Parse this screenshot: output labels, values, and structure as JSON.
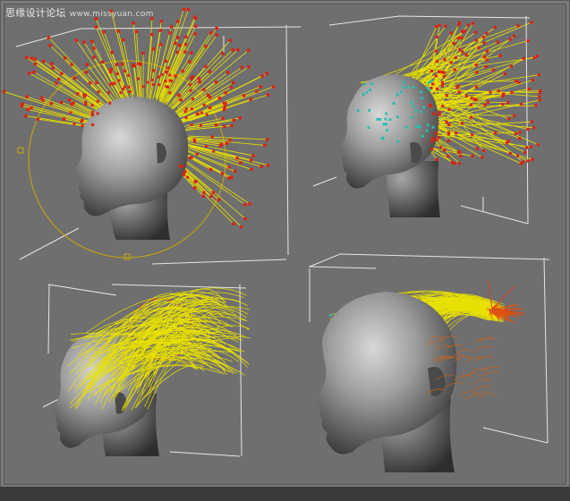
{
  "watermark": {
    "site_name": "思缘设计论坛",
    "site_url": "www.missyuan.com"
  },
  "colors": {
    "viewport_bg": "#6f6f6f",
    "hair_guide": "#e8e000",
    "guide_tip": "#e02010",
    "guide_root": "#20c0b0",
    "gizmo_circle": "#c8a800",
    "bbox_line": "#e6e6e6",
    "head": "#9a9a9a"
  },
  "viewports": [
    {
      "name": "hair-guides-spiky"
    },
    {
      "name": "hair-guides-brushed-back"
    },
    {
      "name": "hair-styled-flowing"
    },
    {
      "name": "hair-styled-ponytail"
    }
  ]
}
